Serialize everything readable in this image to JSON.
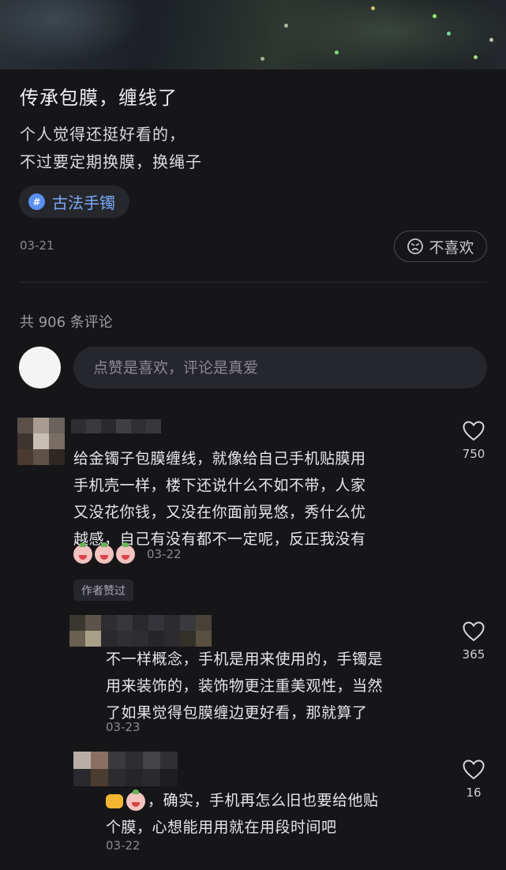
{
  "post": {
    "title": "传承包膜，缠线了",
    "body_line1": "个人觉得还挺好看的，",
    "body_line2": "不过要定期换膜，换绳子",
    "tag": {
      "icon": "#",
      "label": "古法手镯"
    },
    "date": "03-21",
    "dislike_label": "不喜欢"
  },
  "comments_header": {
    "count_text": "共 906 条评论",
    "input_placeholder": "点赞是喜欢，评论是真爱"
  },
  "comments": [
    {
      "text_line1": "给金镯子包膜缠线，就像给自己手机贴膜用",
      "text_line2": "手机壳一样，楼下还说什么不如不带，人家",
      "text_line3": "又没花你钱，又没在你面前晃悠，秀什么优",
      "text_line4": "越感，自己有没有都不一定呢，反正我没有",
      "date": "03-22",
      "likes": "750",
      "badge": "作者赞过"
    },
    {
      "text_line1": "不一样概念，手机是用来使用的，手镯是",
      "text_line2": "用来装饰的，装饰物更注重美观性，当然",
      "text_line3": "了如果觉得包膜缠边更好看，那就算了",
      "date": "03-23",
      "likes": "365"
    },
    {
      "text_line1": "，确实，手机再怎么旧也要给他贴",
      "text_line2": "个膜，心想能用用就在用段时间吧",
      "date": "03-22",
      "likes": "16"
    }
  ],
  "colors": {
    "background": "#161619",
    "tag_text": "#7aa7f8",
    "tag_icon": "#5b8ff0",
    "muted": "#8a8a90"
  },
  "icons": [
    "hashtag-icon",
    "dislike-face-icon",
    "heart-icon",
    "laughing-emoji-icon",
    "fist-emoji-icon"
  ]
}
